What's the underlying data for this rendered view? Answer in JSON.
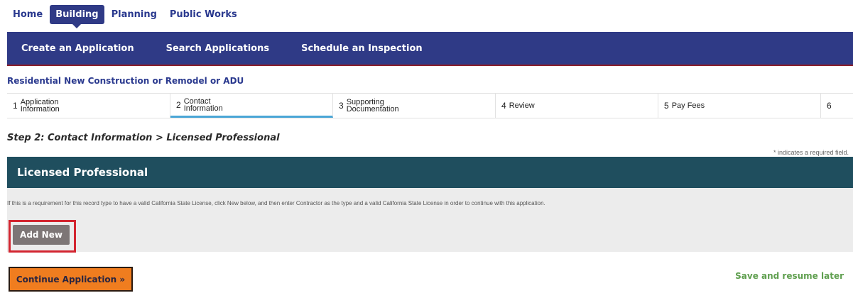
{
  "top_tabs": [
    "Home",
    "Building",
    "Planning",
    "Public Works"
  ],
  "nav": [
    "Create an Application",
    "Search Applications",
    "Schedule an Inspection"
  ],
  "record_type": "Residential New Construction or Remodel or ADU",
  "steps": [
    {
      "num": "1",
      "label": "Application\nInformation"
    },
    {
      "num": "2",
      "label": "Contact\nInformation"
    },
    {
      "num": "3",
      "label": "Supporting\nDocumentation"
    },
    {
      "num": "4",
      "label": "Review"
    },
    {
      "num": "5",
      "label": "Pay Fees"
    },
    {
      "num": "6",
      "label": ""
    }
  ],
  "step_title": "Step 2: Contact Information > Licensed Professional",
  "required_note": "* indicates a required field.",
  "section": {
    "title": "Licensed Professional",
    "description": "If this is a requirement for this record type to have a valid California State License, click New below, and then enter Contractor as the type and a valid California State License in order to continue with this application.",
    "add_label": "Add New"
  },
  "continue_label": "Continue Application »",
  "save_label": "Save and resume later",
  "colors": {
    "nav_blue": "#2f3a86",
    "section_teal": "#1f4e5e",
    "highlight_red": "#d32530",
    "continue_orange": "#f07d1f",
    "save_green": "#5f9f4f"
  }
}
